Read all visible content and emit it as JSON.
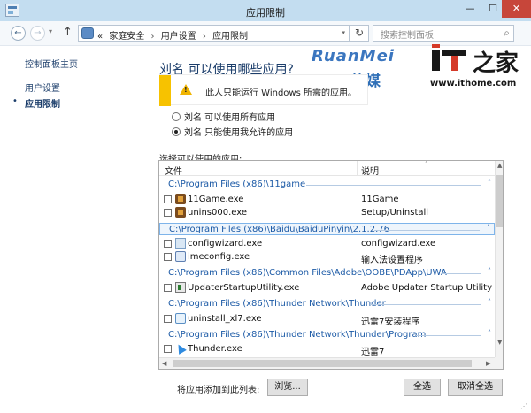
{
  "window": {
    "title": "应用限制",
    "controls": {
      "minimize": "—",
      "maximize": "☐",
      "close": "✕"
    }
  },
  "navigation": {
    "back": "←",
    "forward": "→",
    "history_dropdown": "▾",
    "up": "↑",
    "breadcrumb": {
      "overflow": "«",
      "items": [
        "家庭安全",
        "用户设置",
        "应用限制"
      ],
      "separator": "›"
    },
    "dropdown": "▾",
    "refresh": "↻",
    "search_placeholder": "搜索控制面板",
    "search_icon": "⌕"
  },
  "sidebar": {
    "home": "控制面板主页",
    "items": [
      {
        "label": "用户设置",
        "selected": false
      },
      {
        "label": "应用限制",
        "selected": true
      }
    ],
    "bullet": "•"
  },
  "main": {
    "heading": "刘名 可以使用哪些应用?",
    "warning": {
      "text": "此人只能运行 Windows 所需的应用。",
      "icon": "!"
    },
    "options": [
      {
        "label": "刘名 可以使用所有应用",
        "selected": false
      },
      {
        "label": "刘名 只能使用我允许的应用",
        "selected": true
      }
    ],
    "list_label": "选择可以使用的应用:",
    "columns": {
      "file": "文件",
      "description": "说明",
      "sort_indicator": "˄"
    },
    "groups": [
      {
        "path": "C:\\Program Files (x86)\\11game",
        "chevron": "˄",
        "selected": false,
        "apps": [
          {
            "file": "11Game.exe",
            "description": "11Game",
            "icon": "game-icon"
          },
          {
            "file": "unins000.exe",
            "description": "Setup/Uninstall",
            "icon": "game-icon"
          }
        ]
      },
      {
        "path": "C:\\Program Files (x86)\\Baidu\\BaiduPinyin\\2.1.2.76",
        "chevron": "˄",
        "selected": true,
        "apps": [
          {
            "file": "configwizard.exe",
            "description": "configwizard.exe",
            "icon": "wrench-icon"
          },
          {
            "file": "imeconfig.exe",
            "description": "输入法设置程序",
            "icon": "ime-icon"
          }
        ]
      },
      {
        "path": "C:\\Program Files (x86)\\Common Files\\Adobe\\OOBE\\PDApp\\UWA",
        "chevron": "˄",
        "selected": false,
        "apps": [
          {
            "file": "UpdaterStartupUtility.exe",
            "description": "Adobe Updater Startup Utility",
            "icon": "updater-icon"
          }
        ]
      },
      {
        "path": "C:\\Program Files (x86)\\Thunder Network\\Thunder",
        "chevron": "˄",
        "selected": false,
        "apps": [
          {
            "file": "uninstall_xl7.exe",
            "description": "迅雷7安装程序",
            "icon": "xl-icon"
          }
        ]
      },
      {
        "path": "C:\\Program Files (x86)\\Thunder Network\\Thunder\\Program",
        "chevron": "˄",
        "selected": false,
        "apps": [
          {
            "file": "Thunder.exe",
            "description": "迅雷7",
            "icon": "thunder-icon"
          }
        ]
      }
    ],
    "scroll_arrows": {
      "up": "▲",
      "down": "▼",
      "left": "◀",
      "right": "▶"
    },
    "add_label": "将应用添加到此列表:",
    "buttons": {
      "browse": "浏览...",
      "select_all": "全选",
      "deselect_all": "取消全选"
    },
    "resize_grip": "⋰"
  },
  "watermarks": {
    "ruanmei_latin": "RuanMei",
    "ruanmei_cn": "软媒",
    "ithome_cn": "之家",
    "ithome_url": "www.ithome.com"
  }
}
